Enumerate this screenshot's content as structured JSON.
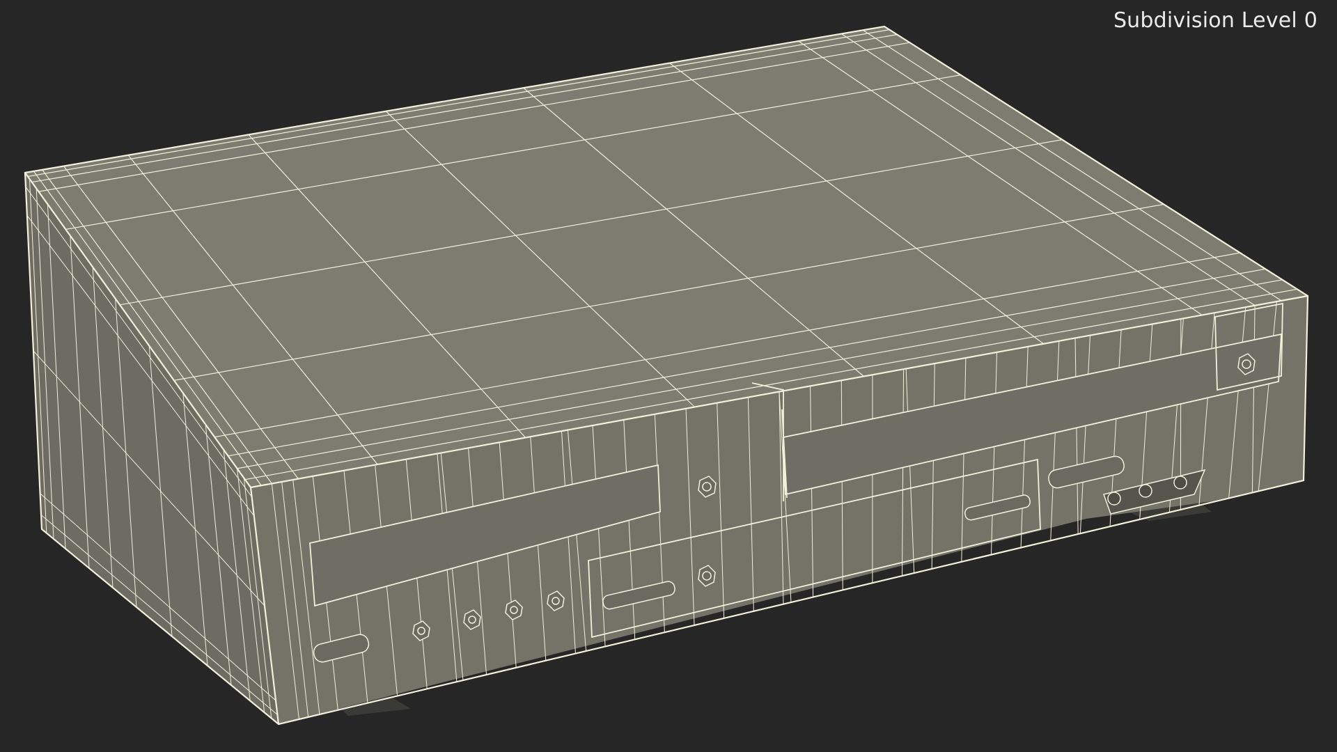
{
  "viewport": {
    "background_color": "#262626",
    "subdivision_label": "Subdivision Level 0"
  },
  "model": {
    "render_style": "wireframe-on-shaded",
    "surface_color": "#7a7a6e",
    "top_color": "#7c7c70",
    "front_color": "#737368",
    "side_color": "#6c6c62",
    "wire_color": "#f3f1dc",
    "shadow_color": "#3a3a36"
  }
}
